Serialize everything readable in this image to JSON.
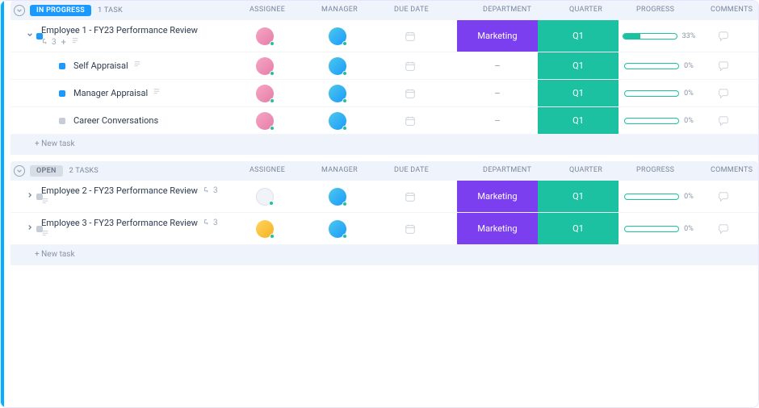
{
  "columns": {
    "assignee": "ASSIGNEE",
    "manager": "MANAGER",
    "due_date": "DUE DATE",
    "department": "DEPARTMENT",
    "quarter": "QUARTER",
    "progress": "PROGRESS",
    "comments": "COMMENTS"
  },
  "sections": [
    {
      "status": "IN PROGRESS",
      "status_color": "blue",
      "task_count": "1 TASK",
      "tasks": [
        {
          "name": "Employee 1 - FY23 Performance Review",
          "type": "parent",
          "subtask_count": "3",
          "show_plus": true,
          "show_doc": true,
          "assignee": "pink",
          "manager": "cyan",
          "due": "cal",
          "dept": "Marketing",
          "qtr": "Q1",
          "progress": 33,
          "subtasks": [
            {
              "name": "Self Appraisal",
              "bullet": "blue",
              "show_doc": true,
              "assignee": "pink",
              "manager": "cyan",
              "due": "cal",
              "dept": "-",
              "qtr": "Q1",
              "progress": 0
            },
            {
              "name": "Manager Appraisal",
              "bullet": "blue",
              "show_doc": true,
              "assignee": "pink",
              "manager": "cyan",
              "due": "cal",
              "dept": "-",
              "qtr": "Q1",
              "progress": 0
            },
            {
              "name": "Career Conversations",
              "bullet": "grey",
              "show_doc": false,
              "assignee": "pink",
              "manager": "cyan",
              "due": "cal",
              "dept": "-",
              "qtr": "Q1",
              "progress": 0
            }
          ]
        }
      ],
      "new_task": "+ New task"
    },
    {
      "status": "OPEN",
      "status_color": "grey",
      "task_count": "2 TASKS",
      "tasks": [
        {
          "name": "Employee 2 - FY23 Performance Review",
          "type": "collapsed",
          "subtask_count": "3",
          "show_doc_below": true,
          "assignee": "white",
          "manager": "cyan",
          "due": "cal",
          "dept": "Marketing",
          "qtr": "Q1",
          "progress": 0
        },
        {
          "name": "Employee 3 - FY23 Performance Review",
          "type": "collapsed",
          "subtask_count": "3",
          "show_doc_below": true,
          "assignee": "yellow",
          "manager": "cyan",
          "due": "cal",
          "dept": "Marketing",
          "qtr": "Q1",
          "progress": 0
        }
      ],
      "new_task": "+ New task"
    }
  ]
}
